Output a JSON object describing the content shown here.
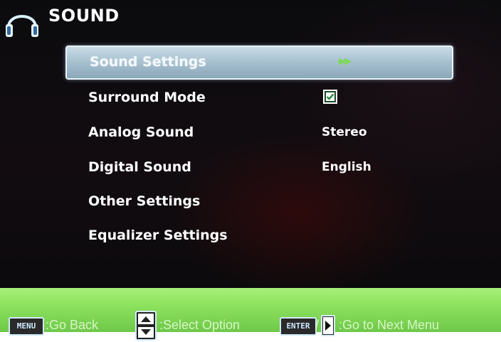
{
  "header": {
    "title": "SOUND",
    "icon": "headphones-icon"
  },
  "menu": {
    "items": [
      {
        "label": "Sound Settings",
        "value": "",
        "indicator": "▶▶",
        "selected": true
      },
      {
        "label": "Surround Mode",
        "value": "",
        "checked": true
      },
      {
        "label": "Analog Sound",
        "value": "Stereo"
      },
      {
        "label": "Digital Sound",
        "value": "English"
      },
      {
        "label": "Other Settings",
        "value": ""
      },
      {
        "label": "Equalizer Settings",
        "value": ""
      }
    ]
  },
  "footer": {
    "menu_key": "MENU",
    "go_back": ":Go Back",
    "select_option": ":Select Option",
    "enter_key": "ENTER",
    "separator": "/",
    "next_menu": ":Go to Next Menu"
  },
  "colors": {
    "footer_green": "#8fe35f",
    "selection": "#a9c2d1",
    "arrow_green": "#7ed957"
  }
}
